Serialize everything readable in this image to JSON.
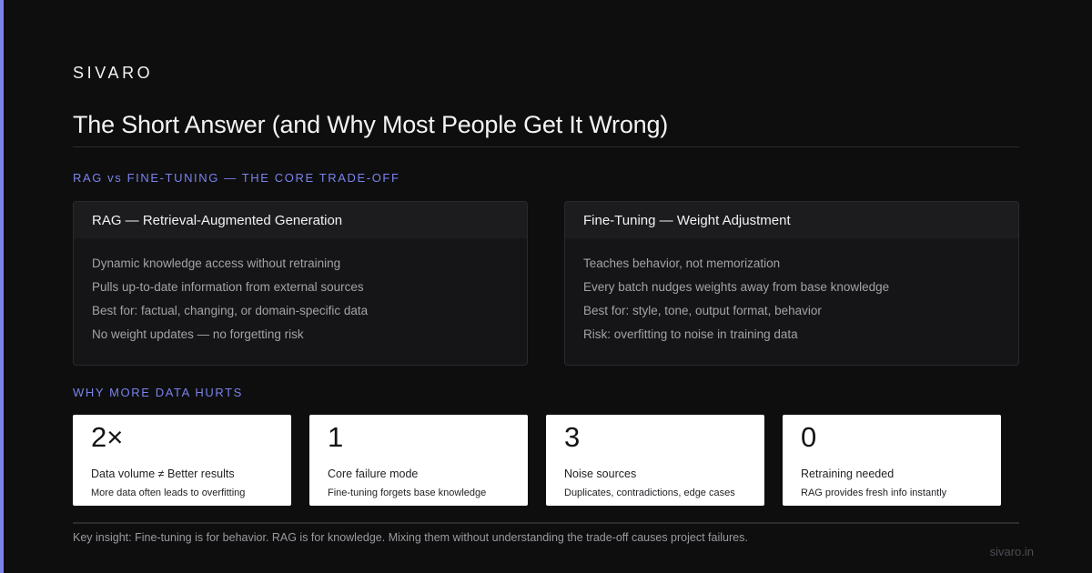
{
  "brand": "SIVARO",
  "title": "The Short Answer (and Why Most People Get It Wrong)",
  "section1_label": "RAG vs FINE-TUNING — THE CORE TRADE-OFF",
  "cards": [
    {
      "title": "RAG — Retrieval-Augmented Generation",
      "items": [
        "Dynamic knowledge access without retraining",
        "Pulls up-to-date information from external sources",
        "Best for: factual, changing, or domain-specific data",
        "No weight updates — no forgetting risk"
      ]
    },
    {
      "title": "Fine-Tuning — Weight Adjustment",
      "items": [
        "Teaches behavior, not memorization",
        "Every batch nudges weights away from base knowledge",
        "Best for: style, tone, output format, behavior",
        "Risk: overfitting to noise in training data"
      ]
    }
  ],
  "section2_label": "WHY MORE DATA HURTS",
  "stats": [
    {
      "value": "2×",
      "title": "Data volume ≠ Better results",
      "desc": "More data often leads to overfitting"
    },
    {
      "value": "1",
      "title": "Core failure mode",
      "desc": "Fine-tuning forgets base knowledge"
    },
    {
      "value": "3",
      "title": "Noise sources",
      "desc": "Duplicates, contradictions, edge cases"
    },
    {
      "value": "0",
      "title": "Retraining needed",
      "desc": "RAG provides fresh info instantly"
    }
  ],
  "insight": "Key insight: Fine-tuning is for behavior. RAG is for knowledge. Mixing them without understanding the trade-off causes project failures.",
  "footer_url": "sivaro.in",
  "colors": {
    "background": "#0e0e0f",
    "accent": "#7b83eb",
    "card": "#151517",
    "stat_card": "#ffffff"
  }
}
